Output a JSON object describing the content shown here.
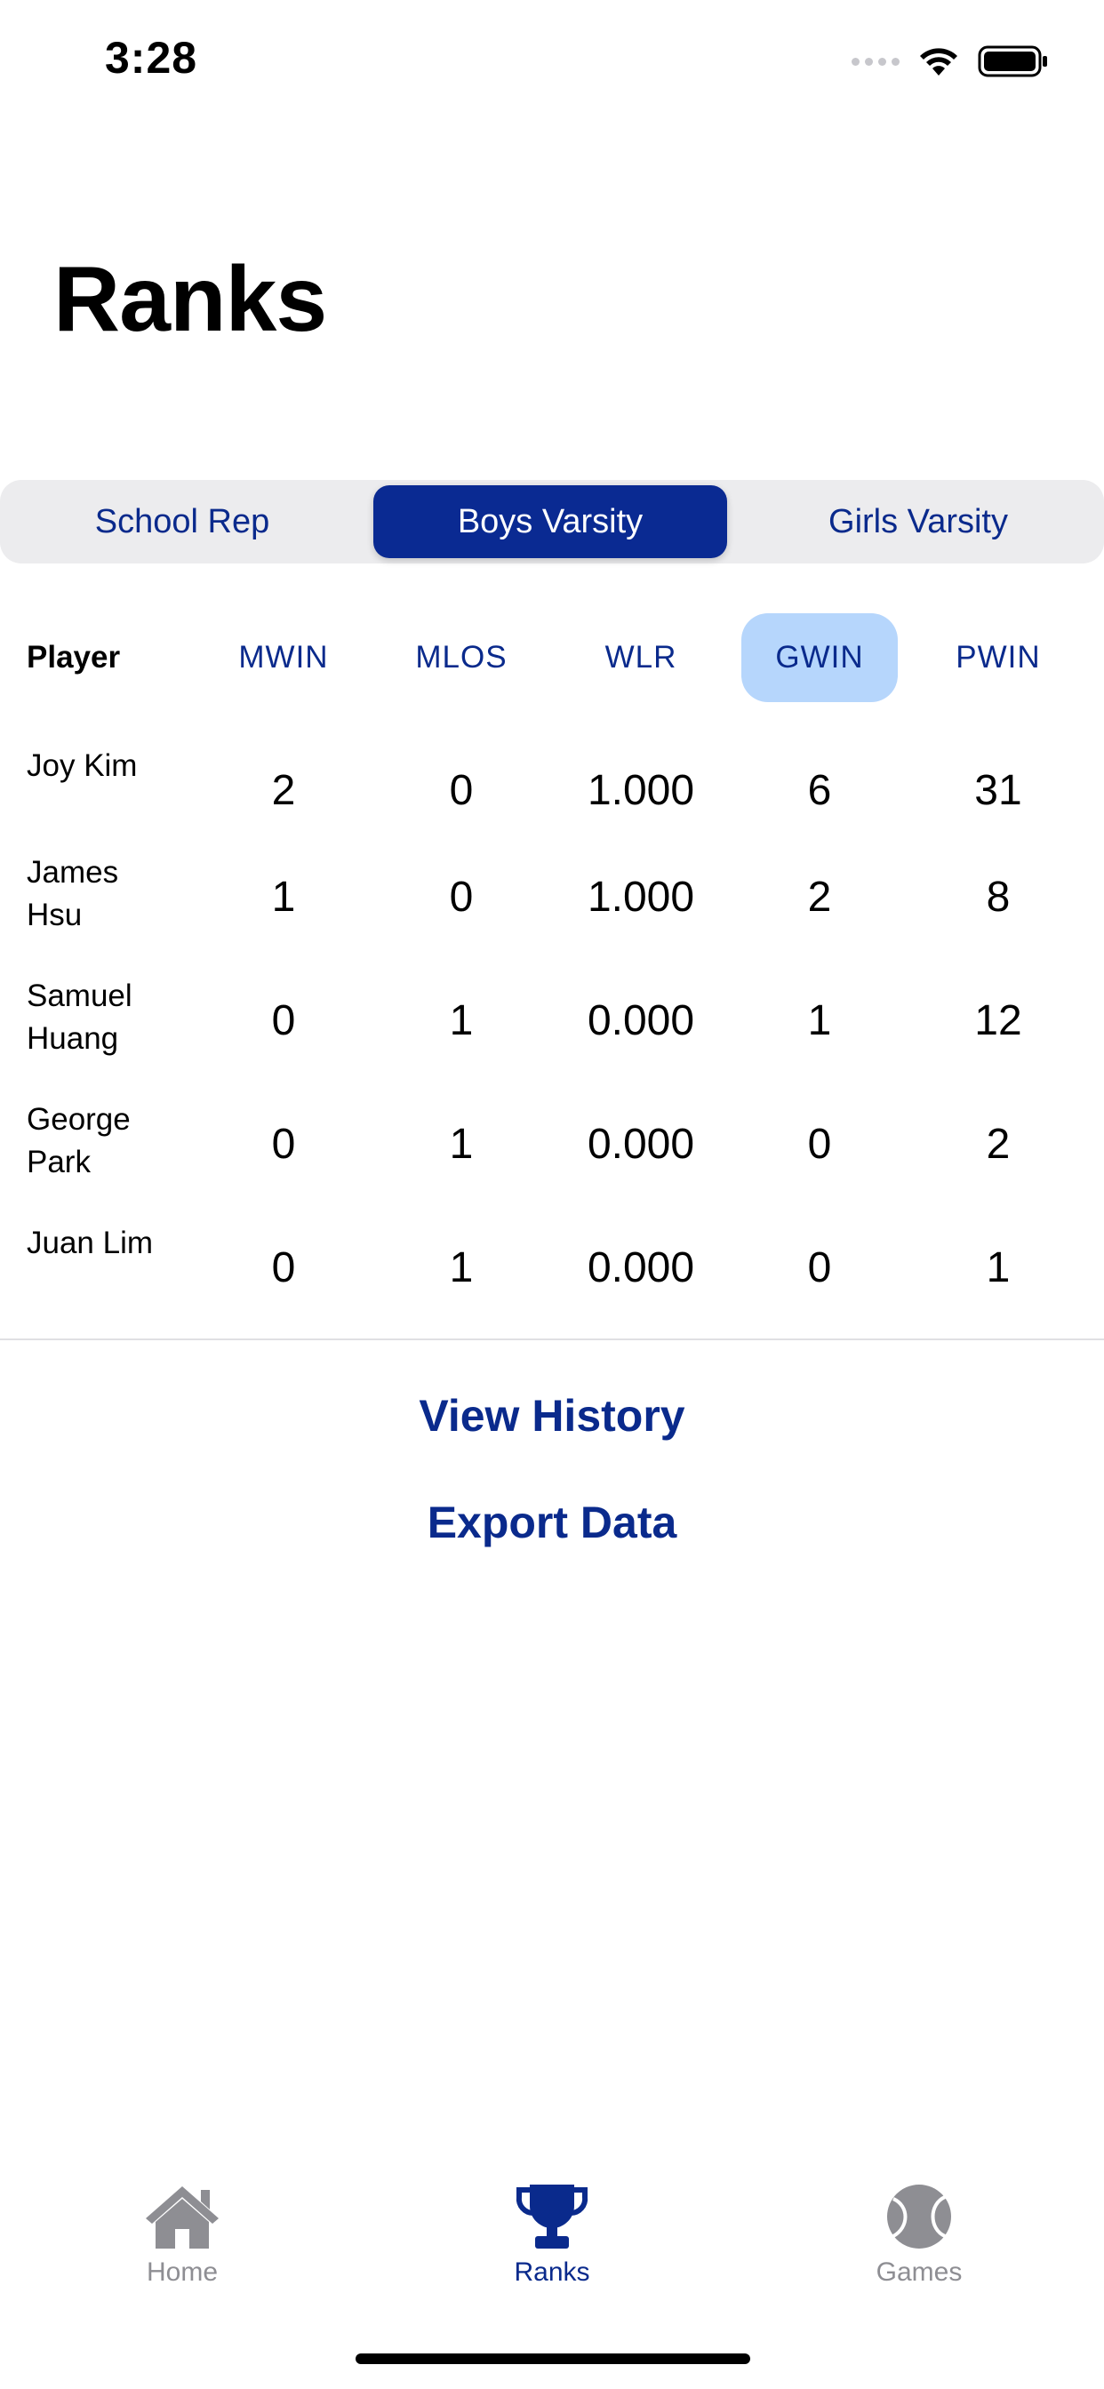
{
  "status": {
    "time": "3:28"
  },
  "title": "Ranks",
  "segments": [
    {
      "label": "School Rep",
      "active": false
    },
    {
      "label": "Boys Varsity",
      "active": true
    },
    {
      "label": "Girls Varsity",
      "active": false
    }
  ],
  "table": {
    "headers": [
      "Player",
      "MWIN",
      "MLOS",
      "WLR",
      "GWIN",
      "PWIN"
    ],
    "sorted_column": "GWIN",
    "rows": [
      {
        "player": "Joy Kim",
        "mwin": "2",
        "mlos": "0",
        "wlr": "1.000",
        "gwin": "6",
        "pwin": "31"
      },
      {
        "player": "James Hsu",
        "mwin": "1",
        "mlos": "0",
        "wlr": "1.000",
        "gwin": "2",
        "pwin": "8"
      },
      {
        "player": "Samuel Huang",
        "mwin": "0",
        "mlos": "1",
        "wlr": "0.000",
        "gwin": "1",
        "pwin": "12"
      },
      {
        "player": "George Park",
        "mwin": "0",
        "mlos": "1",
        "wlr": "0.000",
        "gwin": "0",
        "pwin": "2"
      },
      {
        "player": "Juan Lim",
        "mwin": "0",
        "mlos": "1",
        "wlr": "0.000",
        "gwin": "0",
        "pwin": "1"
      }
    ]
  },
  "actions": {
    "view_history": "View History",
    "export_data": "Export Data"
  },
  "tabbar": {
    "items": [
      {
        "label": "Home",
        "icon": "house-icon",
        "active": false
      },
      {
        "label": "Ranks",
        "icon": "trophy-icon",
        "active": true
      },
      {
        "label": "Games",
        "icon": "tennis-ball-icon",
        "active": false
      }
    ]
  },
  "colors": {
    "accent": "#0a2a8c",
    "highlight": "#b6d6fc",
    "inactive": "#8e8e93",
    "segment_bg": "#ececee"
  }
}
